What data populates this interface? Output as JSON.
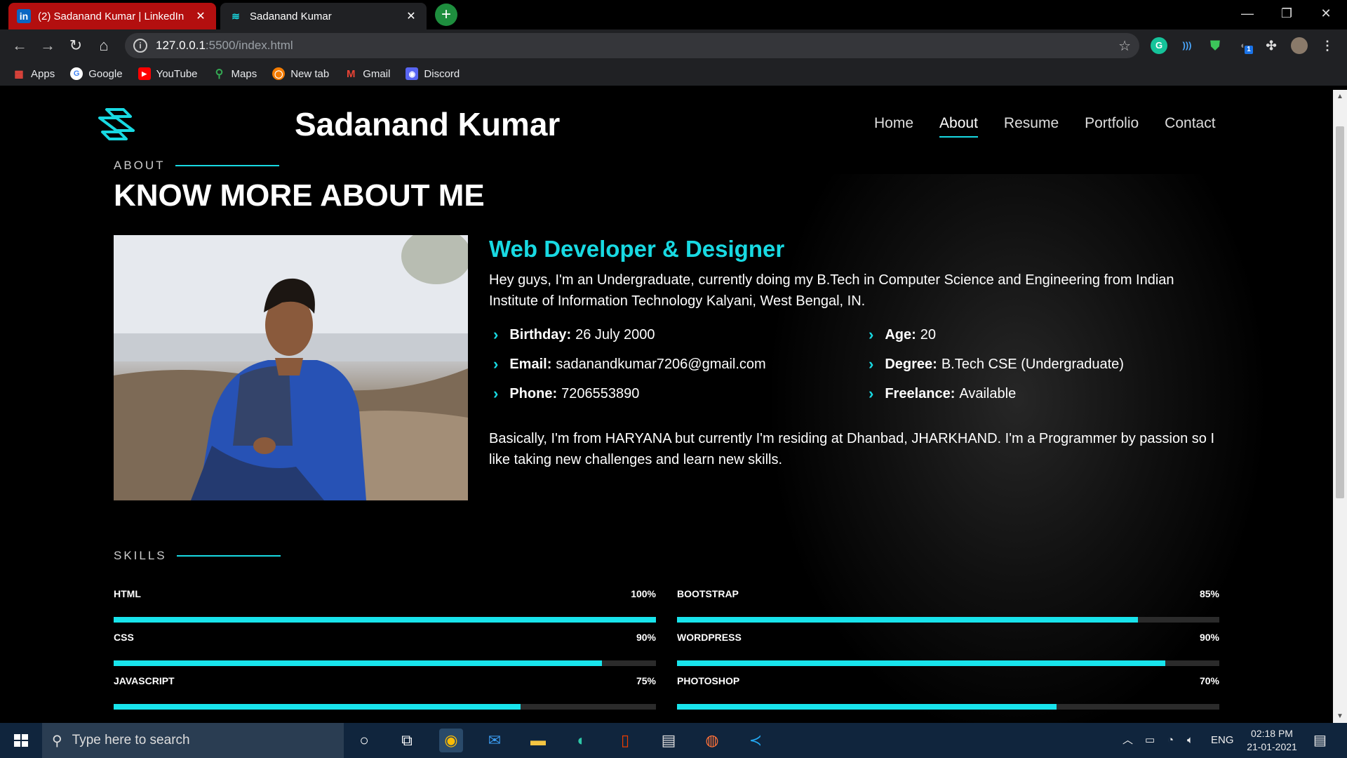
{
  "browser": {
    "tabs": [
      {
        "title": "(2) Sadanand Kumar | LinkedIn",
        "favicon": "in"
      },
      {
        "title": "Sadanand Kumar"
      }
    ],
    "url_host": "127.0.0.1",
    "url_path": ":5500/index.html",
    "bookmarks": [
      "Apps",
      "Google",
      "YouTube",
      "Maps",
      "New tab",
      "Gmail",
      "Discord"
    ],
    "extension_badge": "1"
  },
  "site": {
    "brand": "Sadanand Kumar",
    "nav": [
      "Home",
      "About",
      "Resume",
      "Portfolio",
      "Contact"
    ],
    "active_nav": "About"
  },
  "about": {
    "label": "ABOUT",
    "heading": "KNOW MORE ABOUT ME",
    "role": "Web Developer & Designer",
    "intro": "Hey guys, I'm an Undergraduate, currently doing my B.Tech in Computer Science and Engineering from Indian Institute of Information Technology Kalyani, West Bengal, IN.",
    "facts_left": [
      {
        "key": "Birthday:",
        "value": "26 July 2000"
      },
      {
        "key": "Email:",
        "value": "sadanandkumar7206@gmail.com"
      },
      {
        "key": "Phone:",
        "value": "7206553890"
      }
    ],
    "facts_right": [
      {
        "key": "Age:",
        "value": "20"
      },
      {
        "key": "Degree:",
        "value": "B.Tech CSE (Undergraduate)"
      },
      {
        "key": "Freelance:",
        "value": "Available"
      }
    ],
    "bio": "Basically, I'm from HARYANA but currently I'm residing at Dhanbad, JHARKHAND. I'm a Programmer by passion so I like taking new challenges and learn new skills."
  },
  "skills": {
    "label": "SKILLS",
    "items": [
      {
        "name": "HTML",
        "percent_label": "100%",
        "level": 1.0
      },
      {
        "name": "BOOTSTRAP",
        "percent_label": "85%",
        "level": 0.85
      },
      {
        "name": "CSS",
        "percent_label": "90%",
        "level": 0.9
      },
      {
        "name": "WORDPRESS",
        "percent_label": "90%",
        "level": 0.9
      },
      {
        "name": "JAVASCRIPT",
        "percent_label": "75%",
        "level": 0.75
      },
      {
        "name": "PHOTOSHOP",
        "percent_label": "70%",
        "level": 0.7
      }
    ]
  },
  "taskbar": {
    "search_placeholder": "Type here to search",
    "language": "ENG",
    "time": "02:18 PM",
    "date": "21-01-2021"
  },
  "colors": {
    "accent": "#18d9e2",
    "linkedin_tab": "#b30f0f"
  }
}
